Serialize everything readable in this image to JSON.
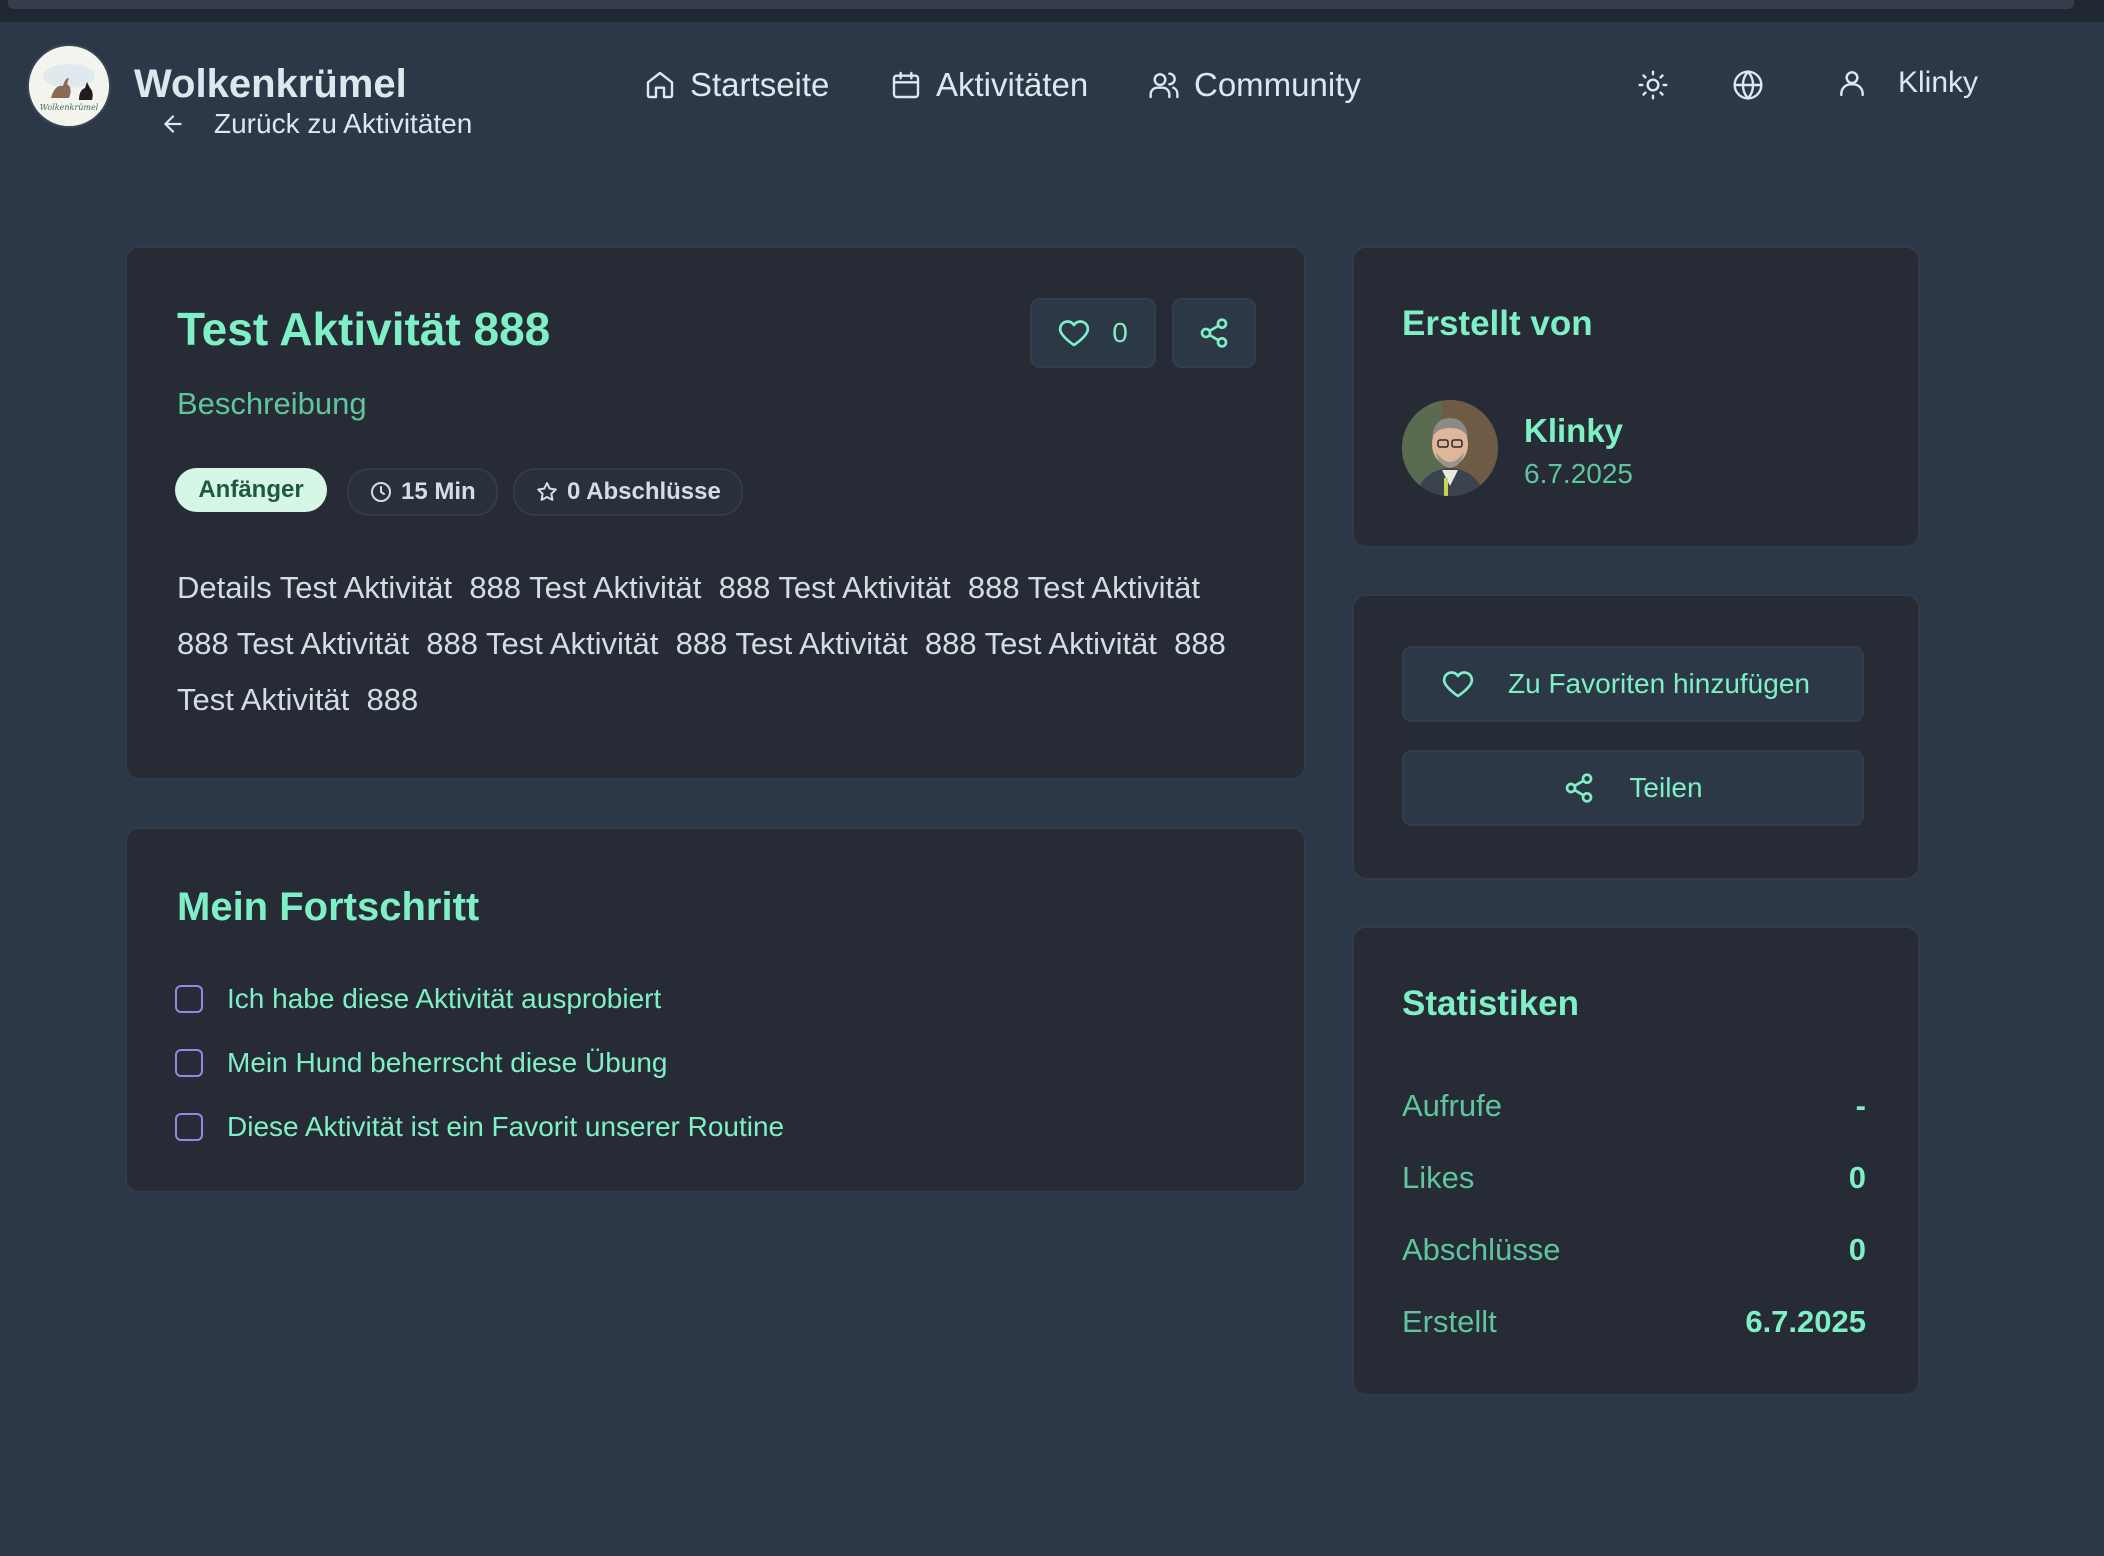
{
  "header": {
    "brand": "Wolkenkrümel",
    "logo_text": "Wolkenkrümel",
    "back_label": "Zurück zu Aktivitäten",
    "nav": [
      {
        "label": "Startseite",
        "icon": "home-icon"
      },
      {
        "label": "Aktivitäten",
        "icon": "calendar-icon"
      },
      {
        "label": "Community",
        "icon": "users-icon"
      }
    ],
    "user_name": "Klinky"
  },
  "activity": {
    "title": "Test Aktivität 888",
    "subtitle": "Beschreibung",
    "likes": "0",
    "level": "Anfänger",
    "duration": "15 Min",
    "completions": "0 Abschlüsse",
    "details": "Details Test Aktivität  888 Test Aktivität  888 Test Aktivität  888 Test Aktivität  888 Test Aktivität  888 Test Aktivität  888 Test Aktivität  888 Test Aktivität  888 Test Aktivität  888"
  },
  "progress": {
    "title": "Mein Fortschritt",
    "items": [
      {
        "label": "Ich habe diese Aktivität ausprobiert",
        "checked": false
      },
      {
        "label": "Mein Hund beherrscht diese Übung",
        "checked": false
      },
      {
        "label": "Diese Aktivität ist ein Favorit unserer Routine",
        "checked": false
      }
    ]
  },
  "author": {
    "title": "Erstellt von",
    "name": "Klinky",
    "date": "6.7.2025"
  },
  "actions": {
    "favorite_label": "Zu Favoriten hinzufügen",
    "share_label": "Teilen"
  },
  "stats": {
    "title": "Statistiken",
    "rows": [
      {
        "label": "Aufrufe",
        "value": "-"
      },
      {
        "label": "Likes",
        "value": "0"
      },
      {
        "label": "Abschlüsse",
        "value": "0"
      },
      {
        "label": "Erstellt",
        "value": "6.7.2025"
      }
    ]
  },
  "colors": {
    "background": "#2c3848",
    "card": "#262b35",
    "accent": "#7ff0c6",
    "accent_muted": "#5fc59c",
    "checkbox": "#9b84e8"
  }
}
